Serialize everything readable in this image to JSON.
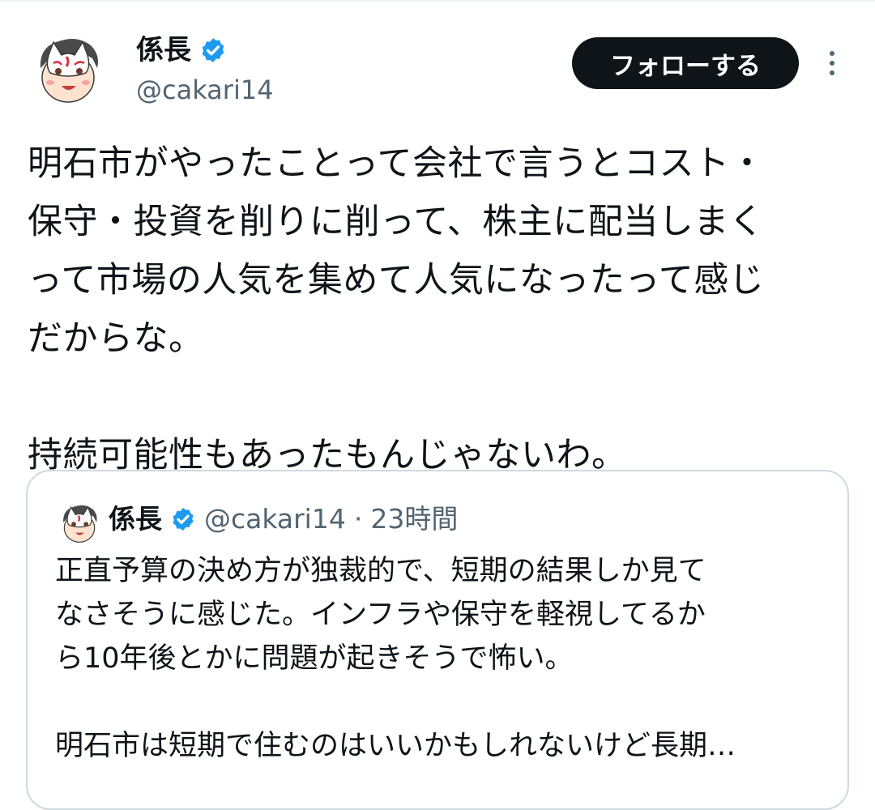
{
  "tweet": {
    "author": {
      "name": "係長",
      "handle": "@cakari14"
    },
    "follow_label": "フォローする",
    "text": "明石市がやったことって会社で言うとコスト・\n保守・投資を削りに削って、株主に配当しまく\nって市場の人気を集めて人気になったって感じ\nだからな。\n\n持続可能性もあったもんじゃないわ。"
  },
  "quote": {
    "author": {
      "name": "係長",
      "handle": "@cakari14"
    },
    "separator": "·",
    "time": "23時間",
    "text": "正直予算の決め方が独裁的で、短期の結果しか見て\nなさそうに感じた。インフラや保守を軽視してるか\nら10年後とかに問題が起きそうで怖い。\n\n明石市は短期で住むのはいいかもしれないけど長期…"
  },
  "colors": {
    "verified": "#1d9bf0",
    "follow_bg": "#0f1419",
    "secondary_text": "#536471",
    "border": "#cfd9de"
  },
  "icons": {
    "verified": "verified-badge-icon",
    "more": "more-vertical-icon"
  }
}
